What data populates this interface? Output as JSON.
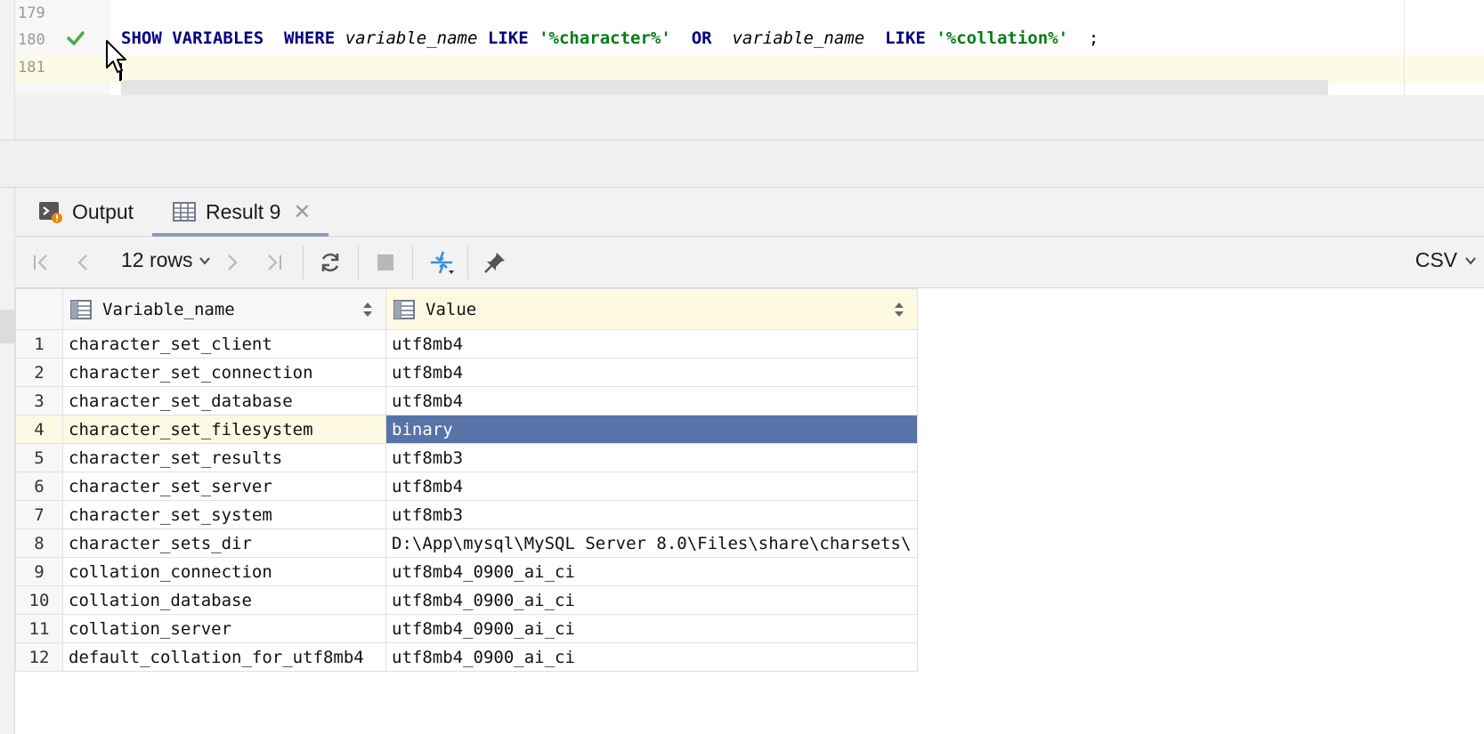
{
  "editor": {
    "line_numbers": [
      "179",
      "180",
      "181"
    ],
    "code": {
      "kw_show_variables": "SHOW VARIABLES",
      "kw_where": "WHERE",
      "ident1": "variable_name",
      "kw_like1": "LIKE",
      "str1": "'%character%'",
      "kw_or": "OR",
      "ident2": "variable_name",
      "kw_like2": "LIKE",
      "str2": "'%collation%'",
      "terminator": ";"
    },
    "status_icon": "check-icon"
  },
  "panel": {
    "tabs": [
      {
        "label": "Output",
        "icon": "console-output-icon"
      },
      {
        "label": "Result 9",
        "icon": "table-grid-icon",
        "active": true
      }
    ],
    "toolbar": {
      "rows_label": "12 rows",
      "export_format": "CSV"
    }
  },
  "grid": {
    "columns": [
      "Variable_name",
      "Value"
    ],
    "rows": [
      {
        "n": "1",
        "name": "character_set_client",
        "value": "utf8mb4"
      },
      {
        "n": "2",
        "name": "character_set_connection",
        "value": "utf8mb4"
      },
      {
        "n": "3",
        "name": "character_set_database",
        "value": "utf8mb4"
      },
      {
        "n": "4",
        "name": "character_set_filesystem",
        "value": "binary"
      },
      {
        "n": "5",
        "name": "character_set_results",
        "value": "utf8mb3"
      },
      {
        "n": "6",
        "name": "character_set_server",
        "value": "utf8mb4"
      },
      {
        "n": "7",
        "name": "character_set_system",
        "value": "utf8mb3"
      },
      {
        "n": "8",
        "name": "character_sets_dir",
        "value": "D:\\App\\mysql\\MySQL Server 8.0\\Files\\share\\charsets\\"
      },
      {
        "n": "9",
        "name": "collation_connection",
        "value": "utf8mb4_0900_ai_ci"
      },
      {
        "n": "10",
        "name": "collation_database",
        "value": "utf8mb4_0900_ai_ci"
      },
      {
        "n": "11",
        "name": "collation_server",
        "value": "utf8mb4_0900_ai_ci"
      },
      {
        "n": "12",
        "name": "default_collation_for_utf8mb4",
        "value": "utf8mb4_0900_ai_ci"
      }
    ],
    "selected_row": "4",
    "colors": {
      "selection": "#5873a8",
      "header_highlight": "#fdf9e3"
    }
  }
}
